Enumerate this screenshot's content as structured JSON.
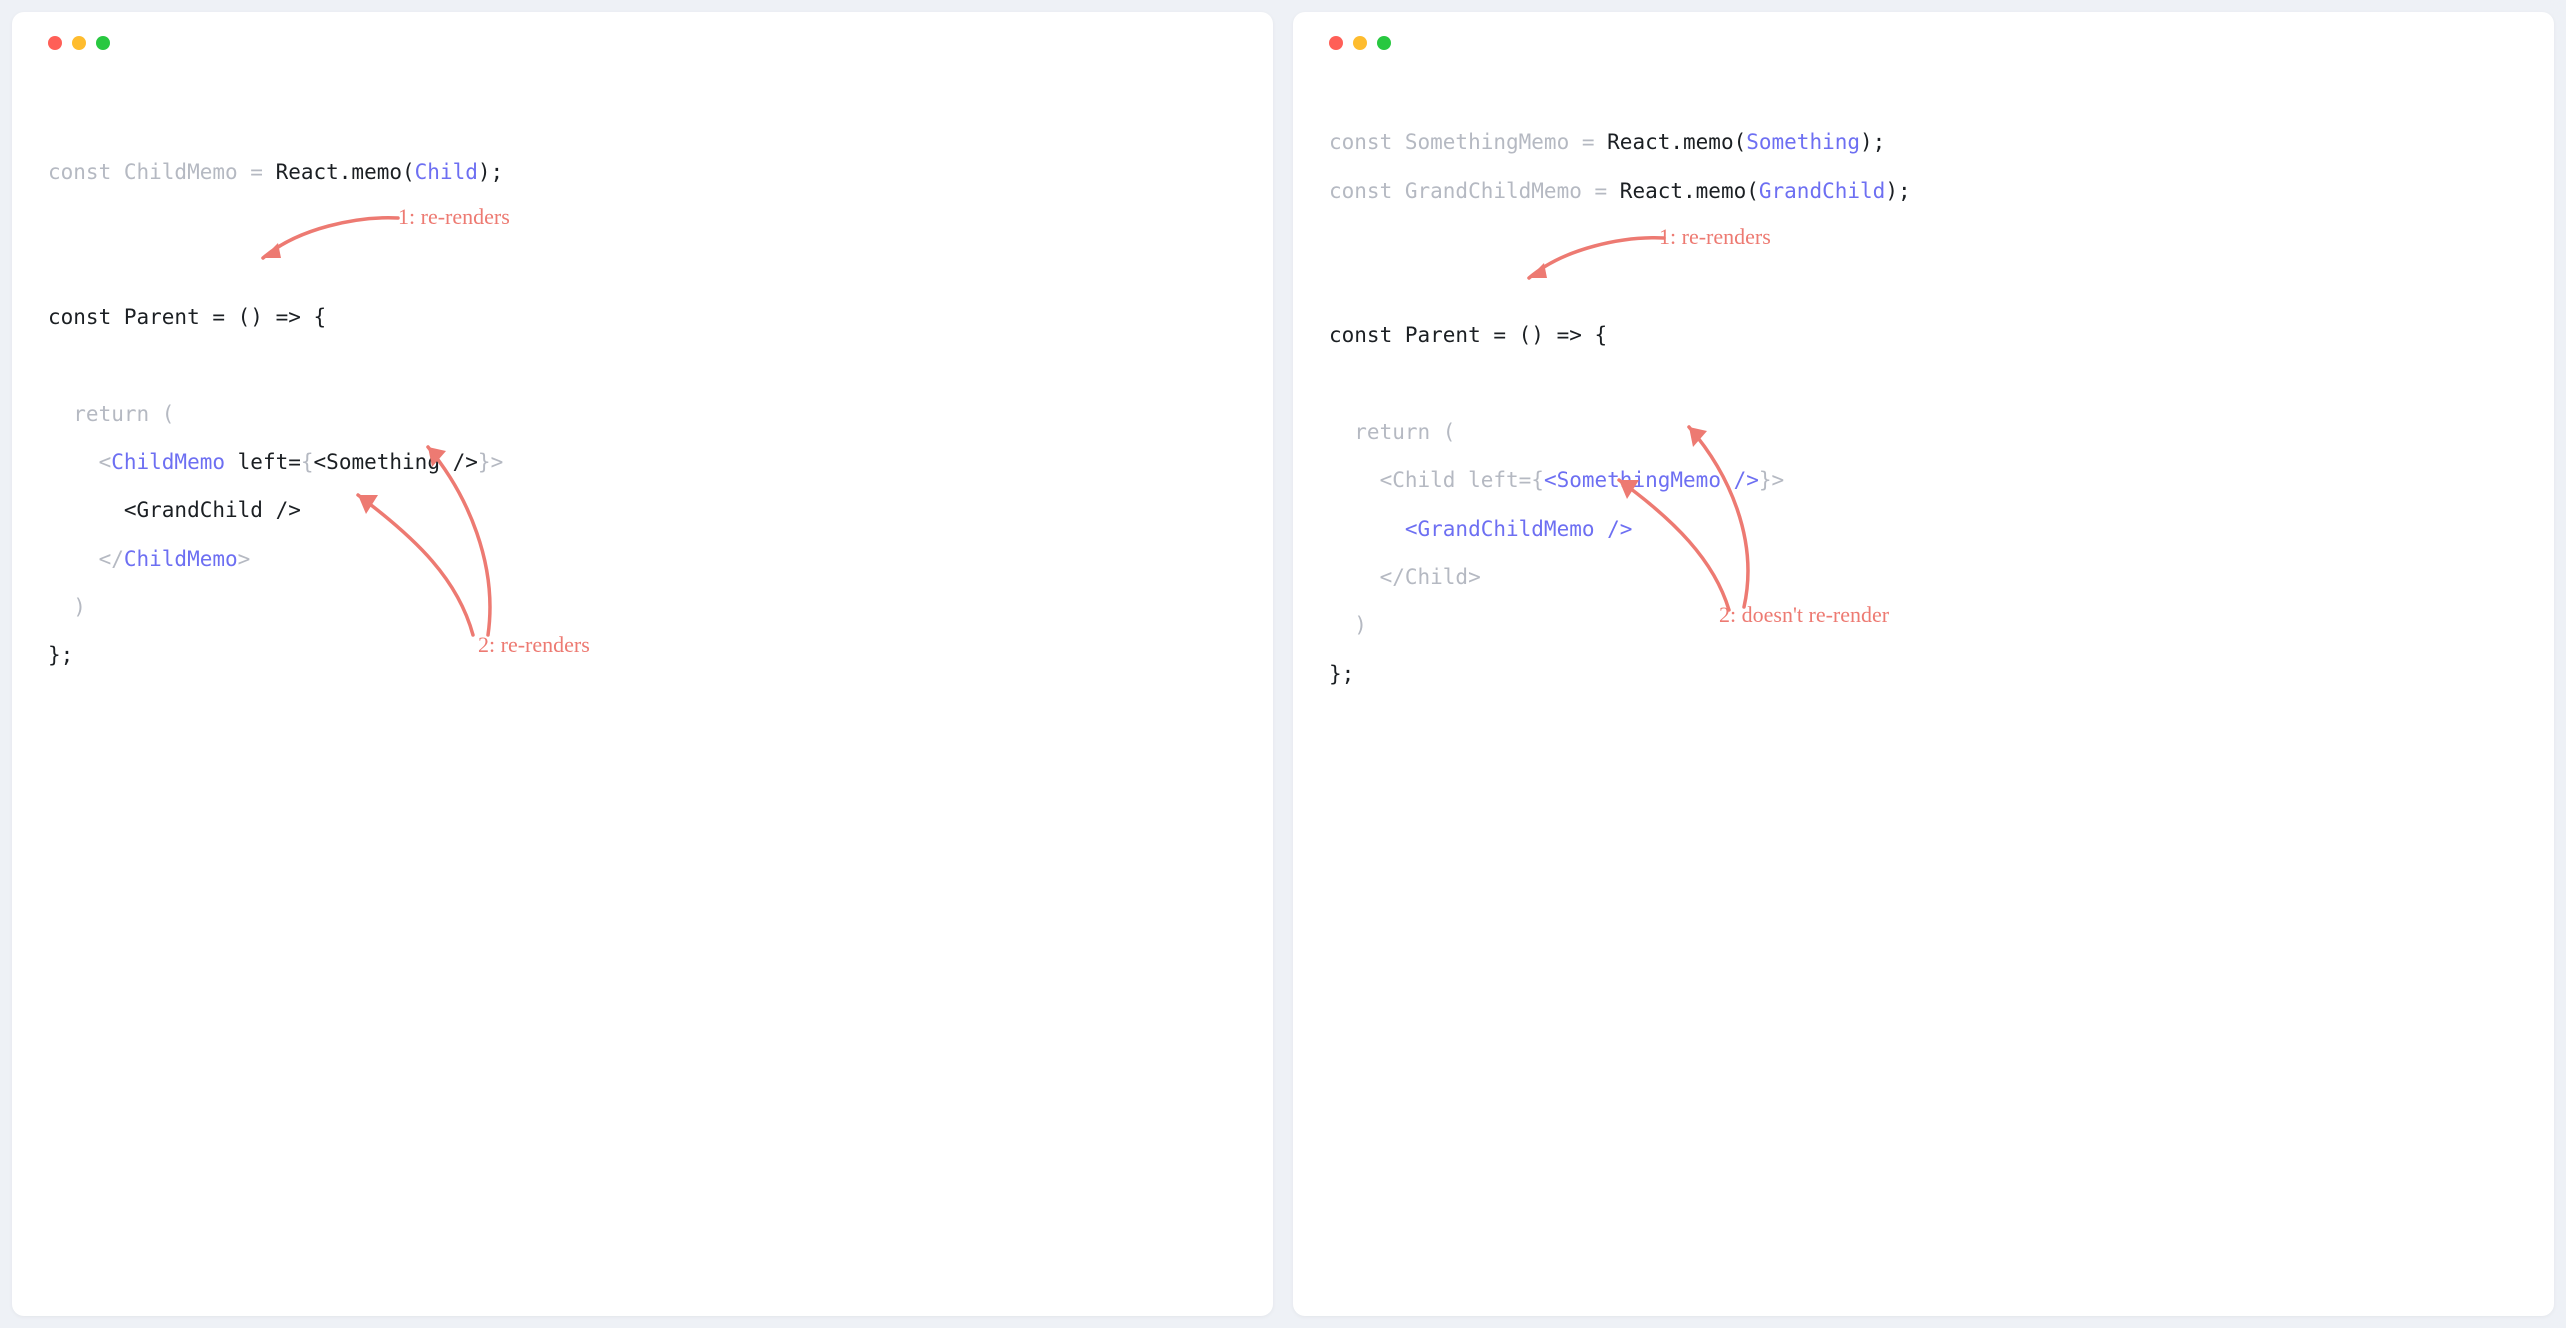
{
  "traffic_colors": {
    "red": "#ff5f57",
    "yellow": "#febc2e",
    "green": "#28c840"
  },
  "annotation_color": "#ed7a72",
  "left": {
    "lines": {
      "l1a": "const ChildMemo = ",
      "l1b": "React.memo(",
      "l1c": "Child",
      "l1d": ");",
      "l2": "const Parent = () => {",
      "l3": "  return (",
      "l4a": "    <",
      "l4b": "ChildMemo",
      "l4c": " left=",
      "l4d": "{",
      "l4e": "<Something />",
      "l4f": "}",
      "l4g": ">",
      "l5": "      <GrandChild />",
      "l6a": "    </",
      "l6b": "ChildMemo",
      "l6c": ">",
      "l7": "  )",
      "l8": "};"
    },
    "annot1": "1: re-renders",
    "annot2": "2: re-renders"
  },
  "right": {
    "lines": {
      "l0a": "const SomethingMemo = ",
      "l0b": "React.memo(",
      "l0c": "Something",
      "l0d": ");",
      "l1a": "const GrandChildMemo = ",
      "l1b": "React.memo(",
      "l1c": "GrandChild",
      "l1d": ");",
      "l2": "const Parent = () => {",
      "l3": "  return (",
      "l4a": "    <Child left=",
      "l4b": "{",
      "l4c": "<SomethingMemo />",
      "l4d": "}",
      "l4e": ">",
      "l5a": "      ",
      "l5b": "<GrandChildMemo />",
      "l6": "    </Child>",
      "l7": "  )",
      "l8": "};"
    },
    "annot1": "1: re-renders",
    "annot2": "2: doesn't re-render"
  }
}
